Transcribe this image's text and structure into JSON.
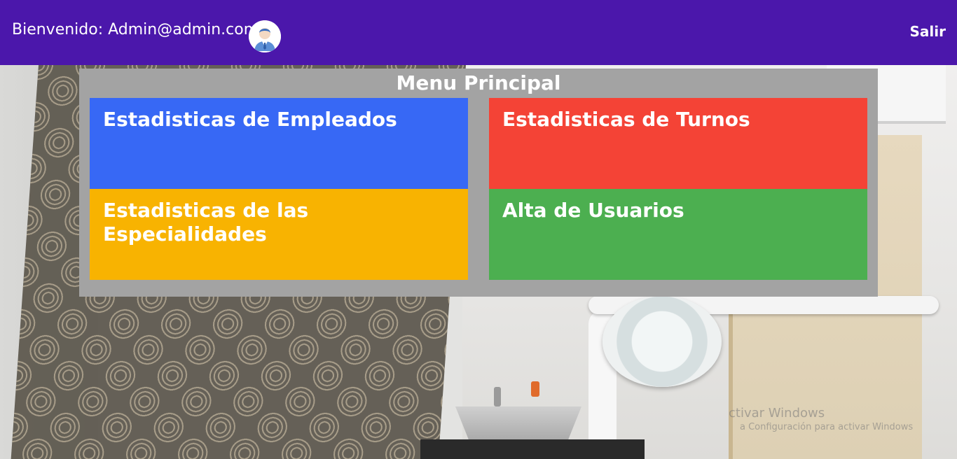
{
  "header": {
    "welcome_text": "Bienvenido: Admin@admin.com",
    "avatar_icon": "user-avatar-icon",
    "logout_label": "Salir",
    "background_color": "#4b17ab"
  },
  "menu": {
    "title": "Menu Principal",
    "tiles": [
      {
        "label": "Estadisticas de Empleados",
        "color": "#3768f5"
      },
      {
        "label": "Estadisticas de Turnos",
        "color": "#f44336"
      },
      {
        "label": "Estadisticas de las Especialidades",
        "color": "#f8b301"
      },
      {
        "label": "Alta de Usuarios",
        "color": "#4caf50"
      }
    ]
  },
  "watermark": {
    "line1": "ctivar Windows",
    "line2": "a Configuración para activar Windows"
  }
}
